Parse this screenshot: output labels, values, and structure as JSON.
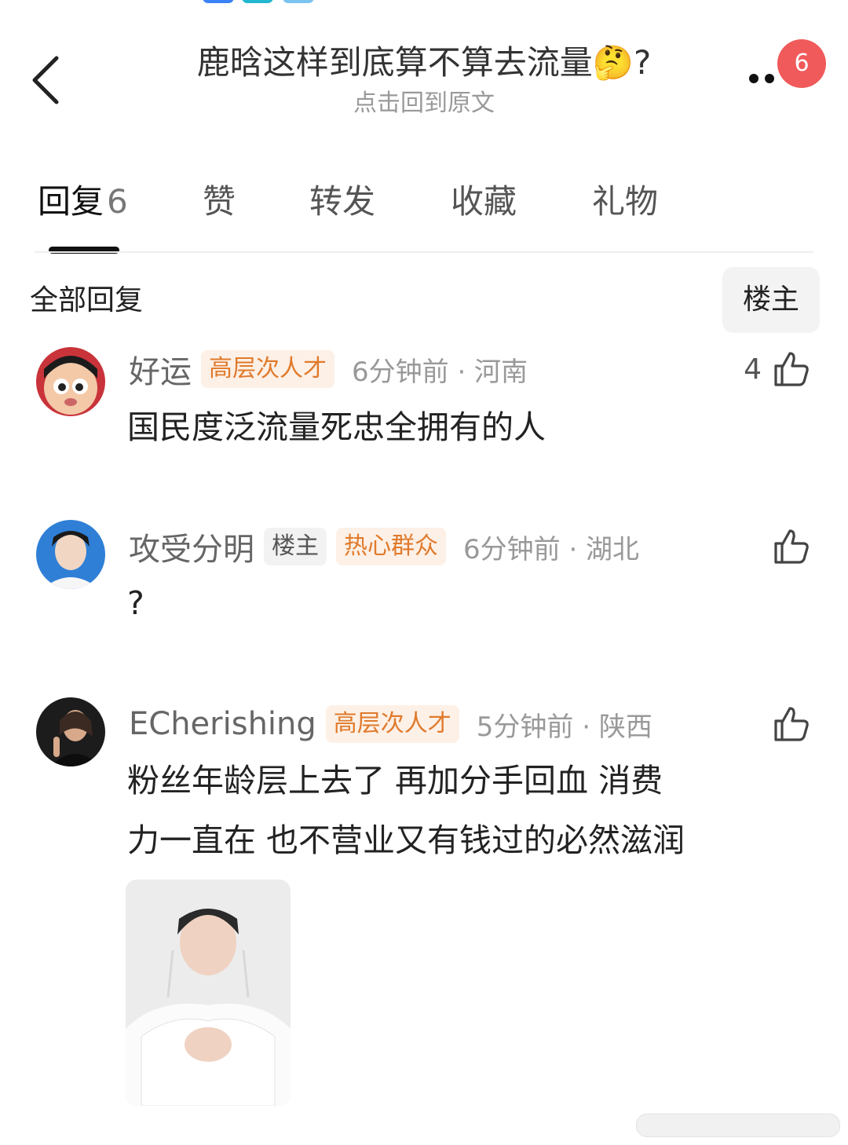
{
  "header": {
    "title": "鹿晗这样到底算不算去流量🤔?",
    "subtitle": "点击回到原文",
    "badge_count": "6"
  },
  "tabs": [
    {
      "label": "回复",
      "count": "6",
      "active": true
    },
    {
      "label": "赞"
    },
    {
      "label": "转发"
    },
    {
      "label": "收藏"
    },
    {
      "label": "礼物"
    }
  ],
  "section": {
    "title": "全部回复",
    "filter_label": "楼主"
  },
  "comments": [
    {
      "username": "好运",
      "tags": [
        "高层次人才"
      ],
      "time": "6分钟前 · 河南",
      "likes": "4",
      "text_lines": [
        "国民度泛流量死忠全拥有的人"
      ]
    },
    {
      "username": "攻受分明",
      "tags": [
        "楼主",
        "热心群众"
      ],
      "time": "6分钟前 · 湖北",
      "likes": "",
      "text_lines": [
        "?"
      ]
    },
    {
      "username": "ECherishing",
      "tags": [
        "高层次人才"
      ],
      "time": "5分钟前 · 陕西",
      "likes": "",
      "text_lines": [
        "粉丝年龄层上去了   再加分手回血   消费",
        "力一直在 也不营业又有钱过的必然滋润"
      ]
    }
  ],
  "icons": {
    "back": "chevron-left-icon",
    "more": "more-dots-icon",
    "like": "thumbs-up-icon"
  },
  "colors": {
    "badge": "#f05a5a",
    "tag_orange": "#e07a2c",
    "tag_orange_bg": "#fdf0e6"
  }
}
